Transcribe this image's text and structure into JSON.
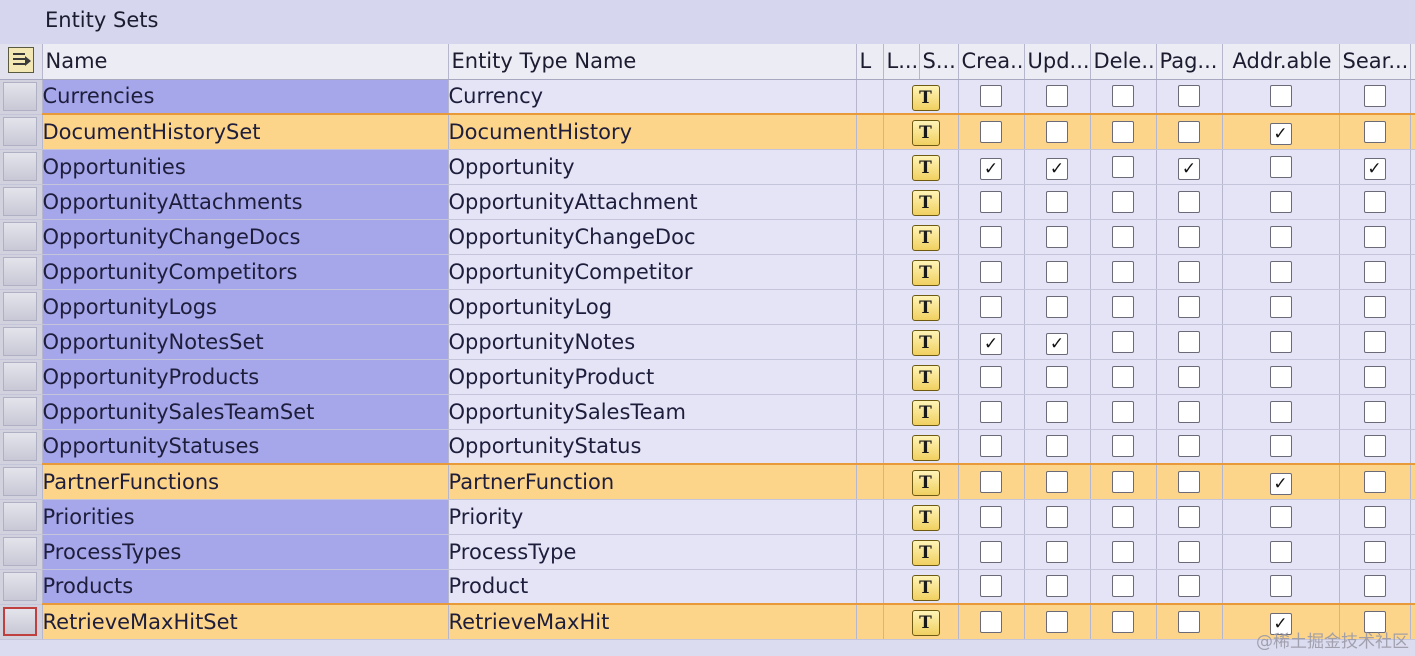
{
  "title": "Entity Sets",
  "columns": {
    "name": "Name",
    "entity_type": "Entity Type Name",
    "l": "L",
    "label": "L...",
    "s": "S...",
    "create": "Crea...",
    "update": "Upd...",
    "delete": "Dele...",
    "page": "Pag...",
    "addressable": "Addr.able",
    "search": "Sear..."
  },
  "rows": [
    {
      "name": "Currencies",
      "type": "Currency",
      "create": false,
      "update": false,
      "delete": false,
      "page": false,
      "addressable": false,
      "search": false,
      "highlighted": false
    },
    {
      "name": "DocumentHistorySet",
      "type": "DocumentHistory",
      "create": false,
      "update": false,
      "delete": false,
      "page": false,
      "addressable": true,
      "search": false,
      "highlighted": true
    },
    {
      "name": "Opportunities",
      "type": "Opportunity",
      "create": true,
      "update": true,
      "delete": false,
      "page": true,
      "addressable": false,
      "search": true,
      "highlighted": false
    },
    {
      "name": "OpportunityAttachments",
      "type": "OpportunityAttachment",
      "create": false,
      "update": false,
      "delete": false,
      "page": false,
      "addressable": false,
      "search": false,
      "highlighted": false
    },
    {
      "name": "OpportunityChangeDocs",
      "type": "OpportunityChangeDoc",
      "create": false,
      "update": false,
      "delete": false,
      "page": false,
      "addressable": false,
      "search": false,
      "highlighted": false
    },
    {
      "name": "OpportunityCompetitors",
      "type": "OpportunityCompetitor",
      "create": false,
      "update": false,
      "delete": false,
      "page": false,
      "addressable": false,
      "search": false,
      "highlighted": false
    },
    {
      "name": "OpportunityLogs",
      "type": "OpportunityLog",
      "create": false,
      "update": false,
      "delete": false,
      "page": false,
      "addressable": false,
      "search": false,
      "highlighted": false
    },
    {
      "name": "OpportunityNotesSet",
      "type": "OpportunityNotes",
      "create": true,
      "update": true,
      "delete": false,
      "page": false,
      "addressable": false,
      "search": false,
      "highlighted": false
    },
    {
      "name": "OpportunityProducts",
      "type": "OpportunityProduct",
      "create": false,
      "update": false,
      "delete": false,
      "page": false,
      "addressable": false,
      "search": false,
      "highlighted": false
    },
    {
      "name": "OpportunitySalesTeamSet",
      "type": "OpportunitySalesTeam",
      "create": false,
      "update": false,
      "delete": false,
      "page": false,
      "addressable": false,
      "search": false,
      "highlighted": false
    },
    {
      "name": "OpportunityStatuses",
      "type": "OpportunityStatus",
      "create": false,
      "update": false,
      "delete": false,
      "page": false,
      "addressable": false,
      "search": false,
      "highlighted": false
    },
    {
      "name": "PartnerFunctions",
      "type": "PartnerFunction",
      "create": false,
      "update": false,
      "delete": false,
      "page": false,
      "addressable": true,
      "search": false,
      "highlighted": true
    },
    {
      "name": "Priorities",
      "type": "Priority",
      "create": false,
      "update": false,
      "delete": false,
      "page": false,
      "addressable": false,
      "search": false,
      "highlighted": false
    },
    {
      "name": "ProcessTypes",
      "type": "ProcessType",
      "create": false,
      "update": false,
      "delete": false,
      "page": false,
      "addressable": false,
      "search": false,
      "highlighted": false
    },
    {
      "name": "Products",
      "type": "Product",
      "create": false,
      "update": false,
      "delete": false,
      "page": false,
      "addressable": false,
      "search": false,
      "highlighted": false
    },
    {
      "name": "RetrieveMaxHitSet",
      "type": "RetrieveMaxHit",
      "create": false,
      "update": false,
      "delete": false,
      "page": false,
      "addressable": true,
      "search": false,
      "highlighted": true
    }
  ],
  "label_icon_text": "T",
  "check_glyph": "✓",
  "watermark": "@稀土掘金技术社区",
  "colors": {
    "name_column_bg": "#a6a6ea",
    "row_bg": "#e4e4f6",
    "highlight_row_bg": "#fdd58a",
    "highlight_border": "#e89a3a"
  },
  "icons": {
    "header_layout": "layout-settings-icon",
    "label_cell": "text-label-icon"
  }
}
